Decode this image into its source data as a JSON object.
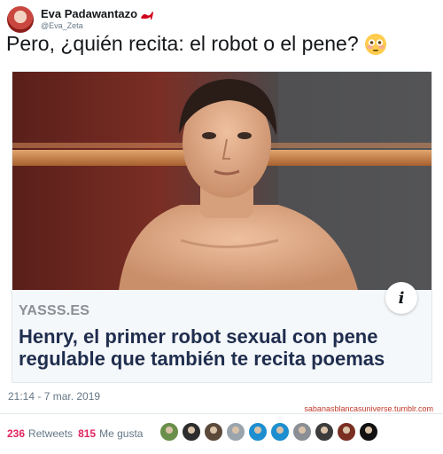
{
  "user": {
    "display_name": "Eva Padawantazo",
    "handle": "@Eva_Zeta"
  },
  "tweet": {
    "text": "Pero, ¿quién recita: el robot o el pene?",
    "emoji": "flushed-face"
  },
  "card": {
    "source": "YASSS.ES",
    "title": "Henry, el primer robot sexual con pene regulable que también te recita poemas",
    "info_icon": "i"
  },
  "timestamp": "21:14 - 7 mar. 2019",
  "watermark": "sabanasblancasuniverse.tumblr.com",
  "stats": {
    "retweets_count": "236",
    "retweets_label": "Retweets",
    "likes_count": "815",
    "likes_label": "Me gusta"
  },
  "liker_avatar_colors": [
    "#6a8f4a",
    "#2d2d2d",
    "#5b4a3a",
    "#9aa4ad",
    "#1d8fd0",
    "#1d8fd0",
    "#8a8f96",
    "#3c3c3c",
    "#7a2e22",
    "#111111"
  ]
}
